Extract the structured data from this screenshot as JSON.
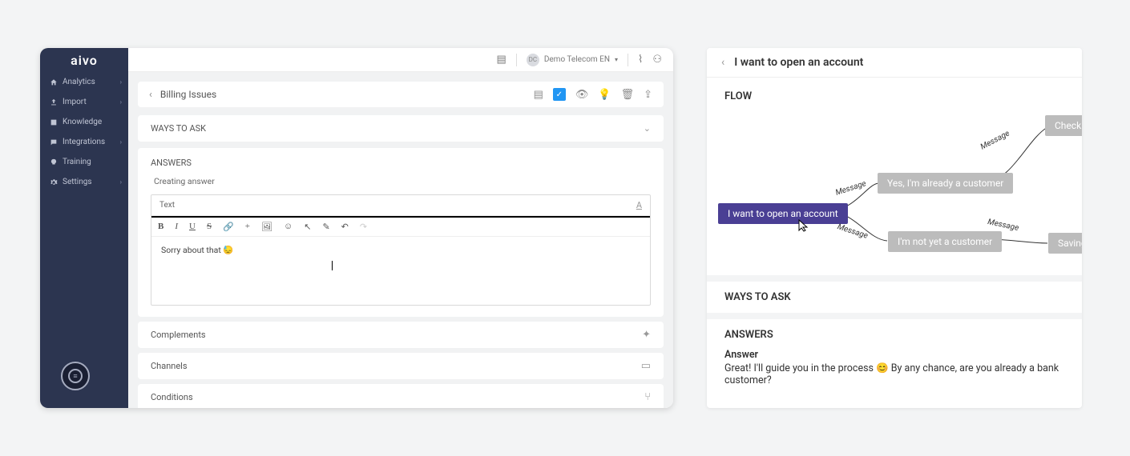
{
  "brand": "aivo",
  "sidebar": {
    "items": [
      {
        "label": "Analytics",
        "icon": "home"
      },
      {
        "label": "Import",
        "icon": "upload"
      },
      {
        "label": "Knowledge",
        "icon": "book"
      },
      {
        "label": "Integrations",
        "icon": "chat"
      },
      {
        "label": "Training",
        "icon": "bulb"
      },
      {
        "label": "Settings",
        "icon": "gear"
      }
    ]
  },
  "topbar": {
    "account_name": "Demo Telecom EN",
    "avatar_initials": "DC"
  },
  "breadcrumb": {
    "title": "Billing Issues"
  },
  "panels": {
    "ways_to_ask": "WAYS TO ASK",
    "answers": "ANSWERS",
    "creating_answer": "Creating answer",
    "text_tab": "Text",
    "editor_content": "Sorry about that 😓",
    "complements": "Complements",
    "channels": "Channels",
    "conditions": "Conditions"
  },
  "right": {
    "title": "I want to open an account",
    "flow_label": "FLOW",
    "nodes": {
      "root": "I want to open an account",
      "yes": "Yes, I'm already a customer",
      "no": "I'm not yet a customer",
      "checking": "Checking",
      "savings": "Savings"
    },
    "edge_label": "Message",
    "ways_to_ask": "WAYS TO ASK",
    "answers": "ANSWERS",
    "answer_sub": "Answer",
    "answer_text": "Great! I'll guide you in the process 😊 By any chance, are you already a bank customer?"
  }
}
